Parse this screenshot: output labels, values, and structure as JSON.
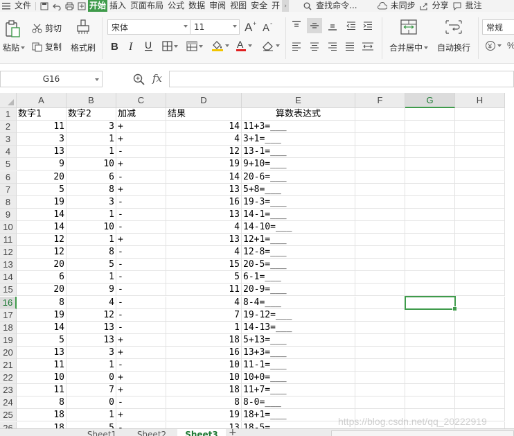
{
  "menubar": {
    "file": "文件",
    "tabs": [
      "开始",
      "插入",
      "页面布局",
      "公式",
      "数据",
      "审阅",
      "视图",
      "安全",
      "开"
    ],
    "search": "查找命令...",
    "sync": "未同步",
    "share": "分享",
    "comment": "批注"
  },
  "ribbon": {
    "paste": "粘贴",
    "cut": "剪切",
    "copy": "复制",
    "format_painter": "格式刷",
    "font_name": "宋体",
    "font_size": "11",
    "merge_center": "合并居中",
    "wrap_text": "自动换行",
    "number_format": "常规",
    "colors": {
      "fill": "#f2c500",
      "font": "#e02020",
      "accent": "#3f9b4b"
    }
  },
  "formula": {
    "name_box": "G16",
    "fx": "fx",
    "value": ""
  },
  "grid": {
    "columns": [
      "A",
      "B",
      "C",
      "D",
      "E",
      "F",
      "G",
      "H"
    ],
    "selected_column": "G",
    "selected_row": "16",
    "rows": [
      {
        "n": "1",
        "a": "数字1",
        "b": "数字2",
        "c": "加减",
        "d": "结果",
        "e": "算数表达式"
      },
      {
        "n": "2",
        "a": "11",
        "b": "3",
        "c": "+",
        "d": "14",
        "e": "11+3=___"
      },
      {
        "n": "3",
        "a": "3",
        "b": "1",
        "c": "+",
        "d": "4",
        "e": "3+1=___"
      },
      {
        "n": "4",
        "a": "13",
        "b": "1",
        "c": "-",
        "d": "12",
        "e": "13-1=___"
      },
      {
        "n": "5",
        "a": "9",
        "b": "10",
        "c": "+",
        "d": "19",
        "e": "9+10=___"
      },
      {
        "n": "6",
        "a": "20",
        "b": "6",
        "c": "-",
        "d": "14",
        "e": "20-6=___"
      },
      {
        "n": "7",
        "a": "5",
        "b": "8",
        "c": "+",
        "d": "13",
        "e": "5+8=___"
      },
      {
        "n": "8",
        "a": "19",
        "b": "3",
        "c": "-",
        "d": "16",
        "e": "19-3=___"
      },
      {
        "n": "9",
        "a": "14",
        "b": "1",
        "c": "-",
        "d": "13",
        "e": "14-1=___"
      },
      {
        "n": "10",
        "a": "14",
        "b": "10",
        "c": "-",
        "d": "4",
        "e": "14-10=___"
      },
      {
        "n": "11",
        "a": "12",
        "b": "1",
        "c": "+",
        "d": "13",
        "e": "12+1=___"
      },
      {
        "n": "12",
        "a": "12",
        "b": "8",
        "c": "-",
        "d": "4",
        "e": "12-8=___"
      },
      {
        "n": "13",
        "a": "20",
        "b": "5",
        "c": "-",
        "d": "15",
        "e": "20-5=___"
      },
      {
        "n": "14",
        "a": "6",
        "b": "1",
        "c": "-",
        "d": "5",
        "e": "6-1=___"
      },
      {
        "n": "15",
        "a": "20",
        "b": "9",
        "c": "-",
        "d": "11",
        "e": "20-9=___"
      },
      {
        "n": "16",
        "a": "8",
        "b": "4",
        "c": "-",
        "d": "4",
        "e": "8-4=___"
      },
      {
        "n": "17",
        "a": "19",
        "b": "12",
        "c": "-",
        "d": "7",
        "e": "19-12=___"
      },
      {
        "n": "18",
        "a": "14",
        "b": "13",
        "c": "-",
        "d": "1",
        "e": "14-13=___"
      },
      {
        "n": "19",
        "a": "5",
        "b": "13",
        "c": "+",
        "d": "18",
        "e": "5+13=___"
      },
      {
        "n": "20",
        "a": "13",
        "b": "3",
        "c": "+",
        "d": "16",
        "e": "13+3=___"
      },
      {
        "n": "21",
        "a": "11",
        "b": "1",
        "c": "-",
        "d": "10",
        "e": "11-1=___"
      },
      {
        "n": "22",
        "a": "10",
        "b": "0",
        "c": "+",
        "d": "10",
        "e": "10+0=___"
      },
      {
        "n": "23",
        "a": "11",
        "b": "7",
        "c": "+",
        "d": "18",
        "e": "11+7=___"
      },
      {
        "n": "24",
        "a": "8",
        "b": "0",
        "c": "-",
        "d": "8",
        "e": "8-0=___"
      },
      {
        "n": "25",
        "a": "18",
        "b": "1",
        "c": "+",
        "d": "19",
        "e": "18+1=___"
      },
      {
        "n": "26",
        "a": "18",
        "b": "5",
        "c": "-",
        "d": "13",
        "e": "18-5=___"
      }
    ]
  },
  "sheets": {
    "tabs": [
      "Sheet1",
      "Sheet2",
      "Sheet3"
    ],
    "active": "Sheet3",
    "add": "+"
  },
  "watermark": "https://blog.csdn.net/qq_20222919"
}
